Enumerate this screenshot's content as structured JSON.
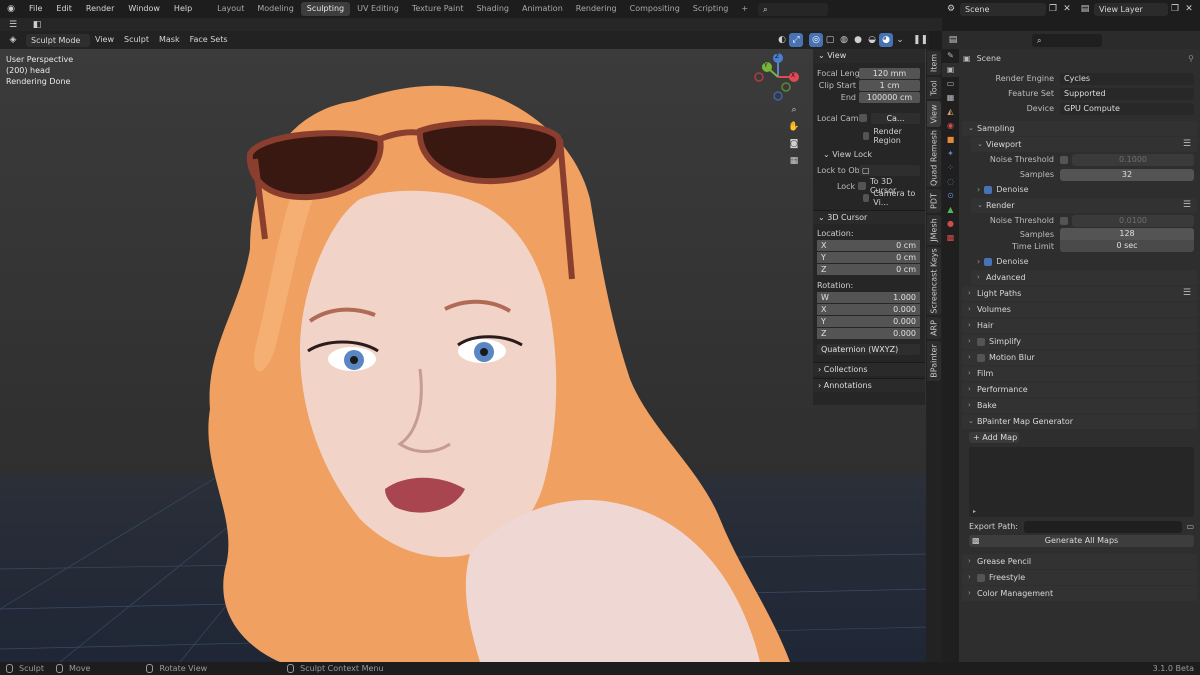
{
  "topbar": {
    "menus": [
      "File",
      "Edit",
      "Render",
      "Window",
      "Help"
    ],
    "workspaces": [
      "Layout",
      "Modeling",
      "Sculpting",
      "UV Editing",
      "Texture Paint",
      "Shading",
      "Animation",
      "Rendering",
      "Compositing",
      "Scripting"
    ],
    "active_workspace": "Sculpting",
    "add_workspace": "+",
    "scene_label": "Scene",
    "view_layer_label": "View Layer"
  },
  "viewport_header": {
    "mode": "Sculpt Mode",
    "menus": [
      "View",
      "Sculpt",
      "Mask",
      "Face Sets"
    ]
  },
  "viewport_info": {
    "line1": "User Perspective",
    "line2": "(200) head",
    "line3": "Rendering Done"
  },
  "gizmo": {
    "z": "Z",
    "y": "Y",
    "x": "X"
  },
  "npanel": {
    "view_section": "View",
    "focal_label": "Focal Leng...",
    "focal_value": "120 mm",
    "clip_start_label": "Clip Start",
    "clip_start_value": "1 cm",
    "end_label": "End",
    "end_value": "100000 cm",
    "local_cam_label": "Local Cam...",
    "local_cam_value": "Ca...",
    "render_region": "Render Region",
    "view_lock_section": "View Lock",
    "lock_to_obj_label": "Lock to Ob...",
    "lock_label": "Lock",
    "to_3d_cursor": "To 3D Cursor",
    "camera_to_view": "Camera to Vi...",
    "cursor_section": "3D Cursor",
    "location_label": "Location:",
    "loc": [
      {
        "axis": "X",
        "value": "0 cm"
      },
      {
        "axis": "Y",
        "value": "0 cm"
      },
      {
        "axis": "Z",
        "value": "0 cm"
      }
    ],
    "rotation_label": "Rotation:",
    "rot": [
      {
        "axis": "W",
        "value": "1.000"
      },
      {
        "axis": "X",
        "value": "0.000"
      },
      {
        "axis": "Y",
        "value": "0.000"
      },
      {
        "axis": "Z",
        "value": "0.000"
      }
    ],
    "rotation_mode": "Quaternion (WXYZ)",
    "collections": "Collections",
    "annotations": "Annotations"
  },
  "vtabs": [
    "Item",
    "Tool",
    "View",
    "Quad Remesh",
    "PDT",
    "JMesh",
    "Screencast Keys",
    "ARP",
    "BPainter"
  ],
  "properties": {
    "scene_title": "Scene",
    "render_engine_label": "Render Engine",
    "render_engine_value": "Cycles",
    "feature_set_label": "Feature Set",
    "feature_set_value": "Supported",
    "device_label": "Device",
    "device_value": "GPU Compute",
    "sampling": "Sampling",
    "viewport": "Viewport",
    "noise_threshold_label": "Noise Threshold",
    "viewport_noise_value": "0.1000",
    "samples_label": "Samples",
    "viewport_samples": "32",
    "denoise": "Denoise",
    "render": "Render",
    "render_noise_value": "0.0100",
    "render_samples": "128",
    "time_limit_label": "Time Limit",
    "time_limit_value": "0 sec",
    "denoise2": "Denoise",
    "advanced": "Advanced",
    "light_paths": "Light Paths",
    "volumes": "Volumes",
    "hair": "Hair",
    "simplify": "Simplify",
    "motion_blur": "Motion Blur",
    "film": "Film",
    "performance": "Performance",
    "bake": "Bake",
    "bpainter": "BPainter Map Generator",
    "add_map": "Add Map",
    "export_path_label": "Export Path:",
    "generate_all": "Generate All Maps",
    "grease_pencil": "Grease Pencil",
    "freestyle": "Freestyle",
    "color_management": "Color Management"
  },
  "status": {
    "sculpt": "Sculpt",
    "move": "Move",
    "rotate": "Rotate View",
    "context": "Sculpt Context Menu",
    "version": "3.1.0 Beta"
  },
  "colors": {
    "accent": "#4772b3",
    "hair": "#f2a060",
    "skin": "#f0d6cf",
    "bg": "#2f2f2f"
  }
}
